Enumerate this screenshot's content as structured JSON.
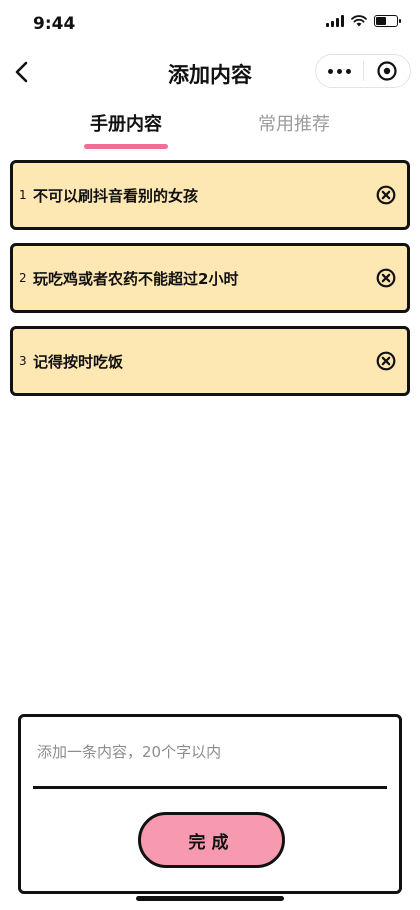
{
  "status_bar": {
    "time": "9:44"
  },
  "nav": {
    "title": "添加内容",
    "back_icon": "chevron-left-icon",
    "more_icon": "more-dots-icon",
    "close_icon": "target-circle-icon"
  },
  "tabs": [
    {
      "label": "手册内容",
      "active": true
    },
    {
      "label": "常用推荐",
      "active": false
    }
  ],
  "items": [
    {
      "index": "1",
      "text": "不可以刷抖音看别的女孩"
    },
    {
      "index": "2",
      "text": "玩吃鸡或者农药不能超过2小时"
    },
    {
      "index": "3",
      "text": "记得按时吃饭"
    }
  ],
  "input": {
    "placeholder": "添加一条内容，20个字以内",
    "value": ""
  },
  "done_button": {
    "label": "完成"
  },
  "colors": {
    "item_background": "#fde7b3",
    "tab_underline": "#ee6f93",
    "done_button": "#f79ab0",
    "border": "#111111"
  }
}
